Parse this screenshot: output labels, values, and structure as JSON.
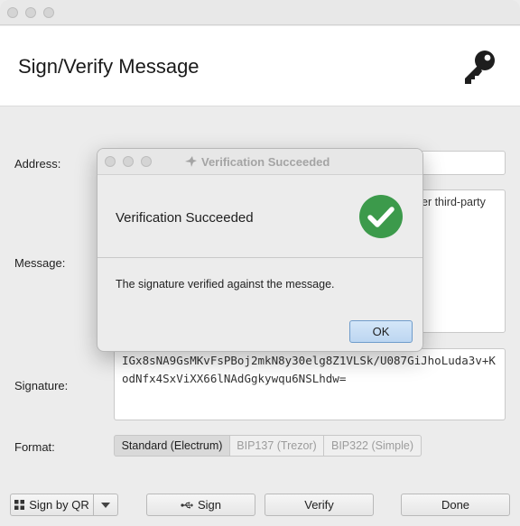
{
  "header": {
    "title": "Sign/Verify Message",
    "icon": "key-icon"
  },
  "form": {
    "address_label": "Address:",
    "message_label": "Message:",
    "message_visible_fragment": "er third-party",
    "signature_label": "Signature:",
    "signature_value": "IGx8sNA9GsMKvFsPBoj2mkN8y30elg8Z1VLSk/U087GiJhoLuda3v+KodNfx4SxViXX66lNAdGgkywqu6NSLhdw=",
    "format_label": "Format:",
    "format_options": [
      "Standard (Electrum)",
      "BIP137 (Trezor)",
      "BIP322 (Simple)"
    ],
    "format_selected": "Standard (Electrum)"
  },
  "buttons": {
    "sign_by_qr": "Sign by QR",
    "sign": "Sign",
    "verify": "Verify",
    "done": "Done"
  },
  "dialog": {
    "title": "Verification Succeeded",
    "heading": "Verification Succeeded",
    "message": "The signature verified against the message.",
    "ok_label": "OK"
  },
  "colors": {
    "success_green": "#3c9a4b",
    "default_button_blue": "#bcd6f1"
  }
}
